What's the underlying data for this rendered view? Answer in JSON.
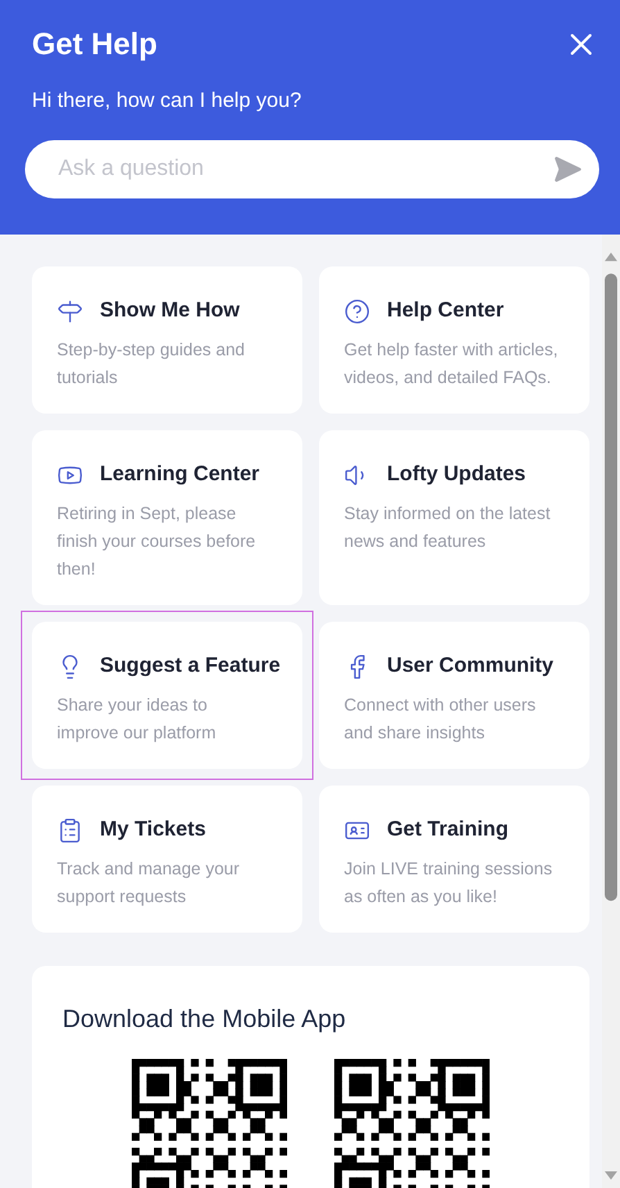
{
  "header": {
    "title": "Get Help",
    "subtitle": "Hi there, how can I help you?",
    "search": {
      "placeholder": "Ask a question"
    }
  },
  "cards": [
    {
      "title": "Show Me How",
      "description": "Step-by-step guides and tutorials",
      "selected": false
    },
    {
      "title": "Help Center",
      "description": "Get help faster with articles, videos, and detailed FAQs.",
      "selected": false
    },
    {
      "title": "Learning Center",
      "description": "Retiring in Sept, please finish your courses before then!",
      "selected": false
    },
    {
      "title": "Lofty Updates",
      "description": "Stay informed on the latest news and features",
      "selected": false
    },
    {
      "title": "Suggest a Feature",
      "description": "Share your ideas to improve our platform",
      "selected": true
    },
    {
      "title": "User Community",
      "description": "Connect with other users and share insights",
      "selected": false
    },
    {
      "title": "My Tickets",
      "description": "Track and manage your support requests",
      "selected": false
    },
    {
      "title": "Get Training",
      "description": "Join LIVE training sessions as often as you like!",
      "selected": false
    }
  ],
  "mobile_app": {
    "title": "Download the Mobile App"
  }
}
